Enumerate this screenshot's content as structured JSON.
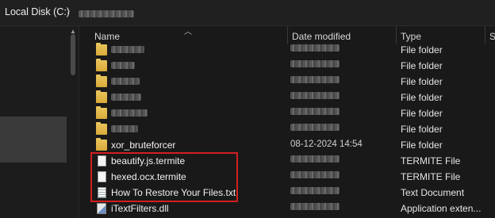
{
  "breadcrumb": {
    "root": "Local Disk (C:)",
    "separator": "›",
    "current_obscured": true
  },
  "columns": [
    {
      "label": "Name"
    },
    {
      "label": "Date modified"
    },
    {
      "label": "Type"
    },
    {
      "label": "S"
    }
  ],
  "rows": [
    {
      "name": "",
      "name_obscured": true,
      "date": "",
      "type": "File folder",
      "icon": "folder-icon"
    },
    {
      "name": "",
      "name_obscured": true,
      "date": "",
      "type": "File folder",
      "icon": "folder-icon"
    },
    {
      "name": "",
      "name_obscured": true,
      "date": "",
      "type": "File folder",
      "icon": "folder-icon"
    },
    {
      "name": "",
      "name_obscured": true,
      "date": "",
      "type": "File folder",
      "icon": "folder-icon"
    },
    {
      "name": "",
      "name_obscured": true,
      "date": "",
      "type": "File folder",
      "icon": "folder-icon"
    },
    {
      "name": "",
      "name_obscured": true,
      "date": "",
      "type": "File folder",
      "icon": "folder-icon"
    },
    {
      "name": "xor_bruteforcer",
      "date": "08-12-2024 14:54",
      "type": "File folder",
      "icon": "folder-icon"
    },
    {
      "name": "beautify.js.termite",
      "date": "",
      "type": "TERMITE File",
      "icon": "file-icon"
    },
    {
      "name": "hexed.ocx.termite",
      "date": "",
      "type": "TERMITE File",
      "icon": "file-icon"
    },
    {
      "name": "How To Restore Your Files.txt",
      "date": "",
      "type": "Text Document",
      "icon": "text-file-icon"
    },
    {
      "name": "iTextFilters.dll",
      "date": "",
      "type": "Application exten...",
      "icon": "dll-file-icon"
    }
  ],
  "colors": {
    "highlight_border": "#d21f1f",
    "background": "#191919",
    "folder": "#e8c45a"
  }
}
